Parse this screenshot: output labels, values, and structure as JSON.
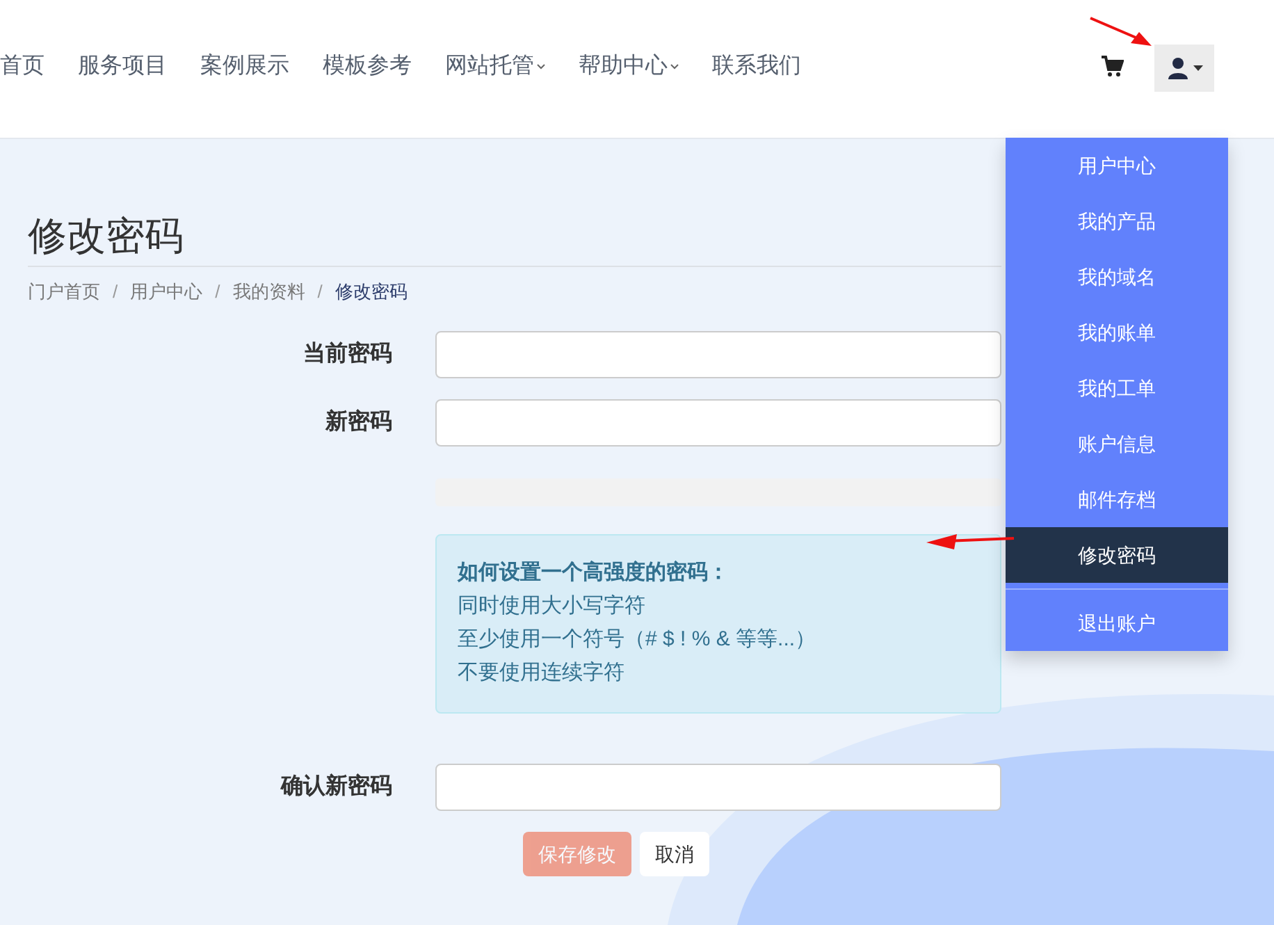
{
  "nav": {
    "items": [
      {
        "label": "首页",
        "has_dropdown": false
      },
      {
        "label": "服务项目",
        "has_dropdown": false
      },
      {
        "label": "案例展示",
        "has_dropdown": false
      },
      {
        "label": "模板参考",
        "has_dropdown": false
      },
      {
        "label": "网站托管",
        "has_dropdown": true
      },
      {
        "label": "帮助中心",
        "has_dropdown": true
      },
      {
        "label": "联系我们",
        "has_dropdown": false
      }
    ],
    "account_menu": {
      "expanded": true,
      "items": [
        {
          "label": "用户中心",
          "selected": false,
          "kind": "link"
        },
        {
          "label": "我的产品",
          "selected": false,
          "kind": "link"
        },
        {
          "label": "我的域名",
          "selected": false,
          "kind": "link"
        },
        {
          "label": "我的账单",
          "selected": false,
          "kind": "link"
        },
        {
          "label": "我的工单",
          "selected": false,
          "kind": "link"
        },
        {
          "label": "账户信息",
          "selected": false,
          "kind": "link"
        },
        {
          "label": "邮件存档",
          "selected": false,
          "kind": "link"
        },
        {
          "label": "修改密码",
          "selected": true,
          "kind": "link"
        },
        {
          "kind": "divider"
        },
        {
          "label": "退出账户",
          "selected": false,
          "kind": "link"
        }
      ]
    }
  },
  "page": {
    "title": "修改密码",
    "breadcrumb_separator": "/",
    "breadcrumb": [
      {
        "label": "门户首页",
        "selected": false
      },
      {
        "label": "用户中心",
        "selected": false
      },
      {
        "label": "我的资料",
        "selected": false
      },
      {
        "label": "修改密码",
        "selected": true
      }
    ]
  },
  "form": {
    "fields": [
      {
        "label": "当前密码",
        "kind": "input"
      },
      {
        "label": "新密码",
        "kind": "input"
      },
      {
        "kind": "strength_meter"
      },
      {
        "kind": "tips",
        "title": "如何设置一个高强度的密码：",
        "lines": [
          "同时使用大小写字符",
          "至少使用一个符号（# $ ! % & 等等...）",
          "不要使用连续字符"
        ]
      },
      {
        "label": "确认新密码",
        "kind": "input"
      }
    ],
    "buttons": [
      {
        "label": "保存修改",
        "kind": "primary",
        "disabled": true
      },
      {
        "label": "取消",
        "kind": "default",
        "disabled": false
      }
    ]
  }
}
